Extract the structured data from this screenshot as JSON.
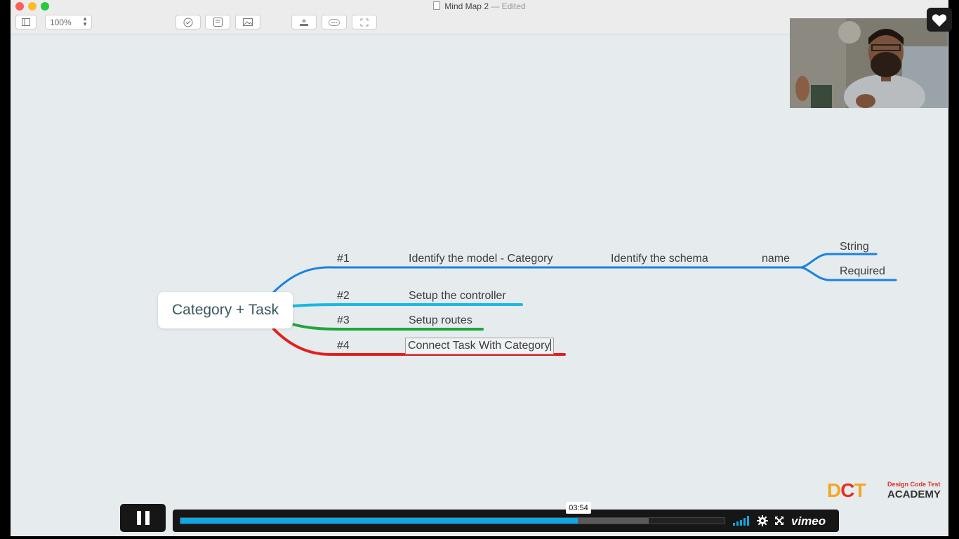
{
  "window": {
    "title": "Mind Map 2",
    "edited": "— Edited",
    "traffic_colors": [
      "#fc5f57",
      "#fdbc2e",
      "#28c840"
    ]
  },
  "toolbar": {
    "zoom_value": "100%",
    "icons": [
      "sidebar-icon",
      "checkmark-icon",
      "note-icon",
      "image-icon",
      "add-child-icon",
      "relationship-icon",
      "focus-icon"
    ]
  },
  "mindmap": {
    "central": "Category + Task",
    "branches": [
      {
        "number": "#1",
        "label": "Identify the model - Category",
        "color": "#1a82e2",
        "children": [
          {
            "label": "Identify the schema",
            "children": [
              {
                "label": "name",
                "children": [
                  {
                    "label": "String"
                  },
                  {
                    "label": "Required"
                  }
                ]
              }
            ]
          }
        ]
      },
      {
        "number": "#2",
        "label": "Setup the controller",
        "color": "#1ab8e0"
      },
      {
        "number": "#3",
        "label": "Setup routes",
        "color": "#20a53b"
      },
      {
        "number": "#4",
        "label": "Connect Task With Category",
        "color": "#e41e1e",
        "editing": true
      }
    ]
  },
  "player": {
    "time": "03:54",
    "progress_percent": 73,
    "buffered_percent": 86,
    "brand": "vimeo",
    "accent": "#12a6e4"
  },
  "watermark": {
    "letters": "DCT",
    "tagline": "Design Code Test",
    "name": "ACADEMY"
  }
}
